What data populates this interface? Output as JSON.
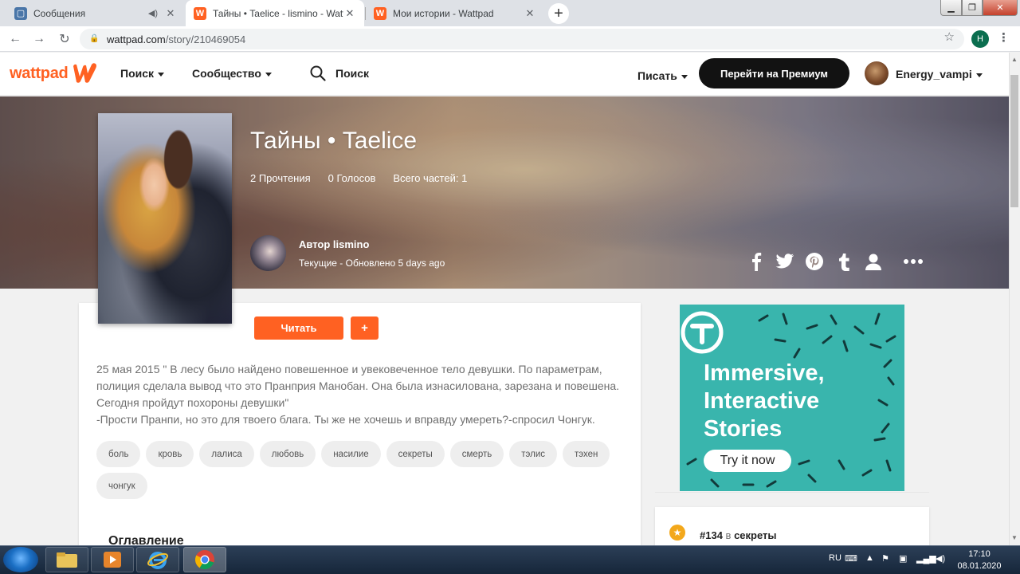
{
  "browser": {
    "tabs": [
      {
        "title": "Сообщения",
        "favicon": "vk-message-icon",
        "active": false
      },
      {
        "title": "Тайны • Taelice - lismino - Wattpad",
        "favicon": "wattpad-icon",
        "active": true
      },
      {
        "title": "Мои истории - Wattpad",
        "favicon": "wattpad-icon",
        "active": false
      }
    ],
    "url_host": "wattpad.com",
    "url_path": "/story/210469054",
    "profile_initial": "H"
  },
  "header": {
    "logo_text": "wattpad",
    "nav": {
      "search_menu": "Поиск",
      "community_menu": "Сообщество"
    },
    "search_label": "Поиск",
    "write_menu": "Писать",
    "premium_button": "Перейти на Премиум",
    "username": "Energy_vampi"
  },
  "story": {
    "title": "Тайны • Taelice",
    "reads": "2 Прочтения",
    "votes": "0 Голосов",
    "parts": "Всего частей: 1",
    "author_label": "Автор lismino",
    "meta": "Текущие - Обновлено 5 days ago",
    "read_button": "Читать",
    "add_button": "+",
    "description": [
      "25 мая 2015 \" В лесу было найдено повешенное и увековеченное тело девушки. По параметрам,",
      "полиция сделала вывод что это Пранприя Манобан. Она была изнасилована, зарезана и повешена.",
      "Сегодня пройдут похороны девушки\"",
      "-Прости Пранпи, но это для твоего блага. Ты же не хочешь и вправду умереть?-спросил Чонгук."
    ],
    "tags": [
      "боль",
      "кровь",
      "лалиса",
      "любовь",
      "насилие",
      "секреты",
      "смерть",
      "тэлис",
      "тэхен",
      "чонгук"
    ],
    "toc_heading": "Оглавление"
  },
  "sidebar": {
    "ad": {
      "line1": "Immersive,",
      "line2": "Interactive",
      "line3": "Stories",
      "button": "Try it now"
    },
    "rank": {
      "number": "#134",
      "in": "в",
      "category": "секреты"
    }
  },
  "taskbar": {
    "lang": "RU",
    "time": "17:10",
    "date": "08.01.2020"
  },
  "colors": {
    "brand": "#ff6122",
    "premium": "#121212",
    "ad_bg": "#39b5ad"
  }
}
